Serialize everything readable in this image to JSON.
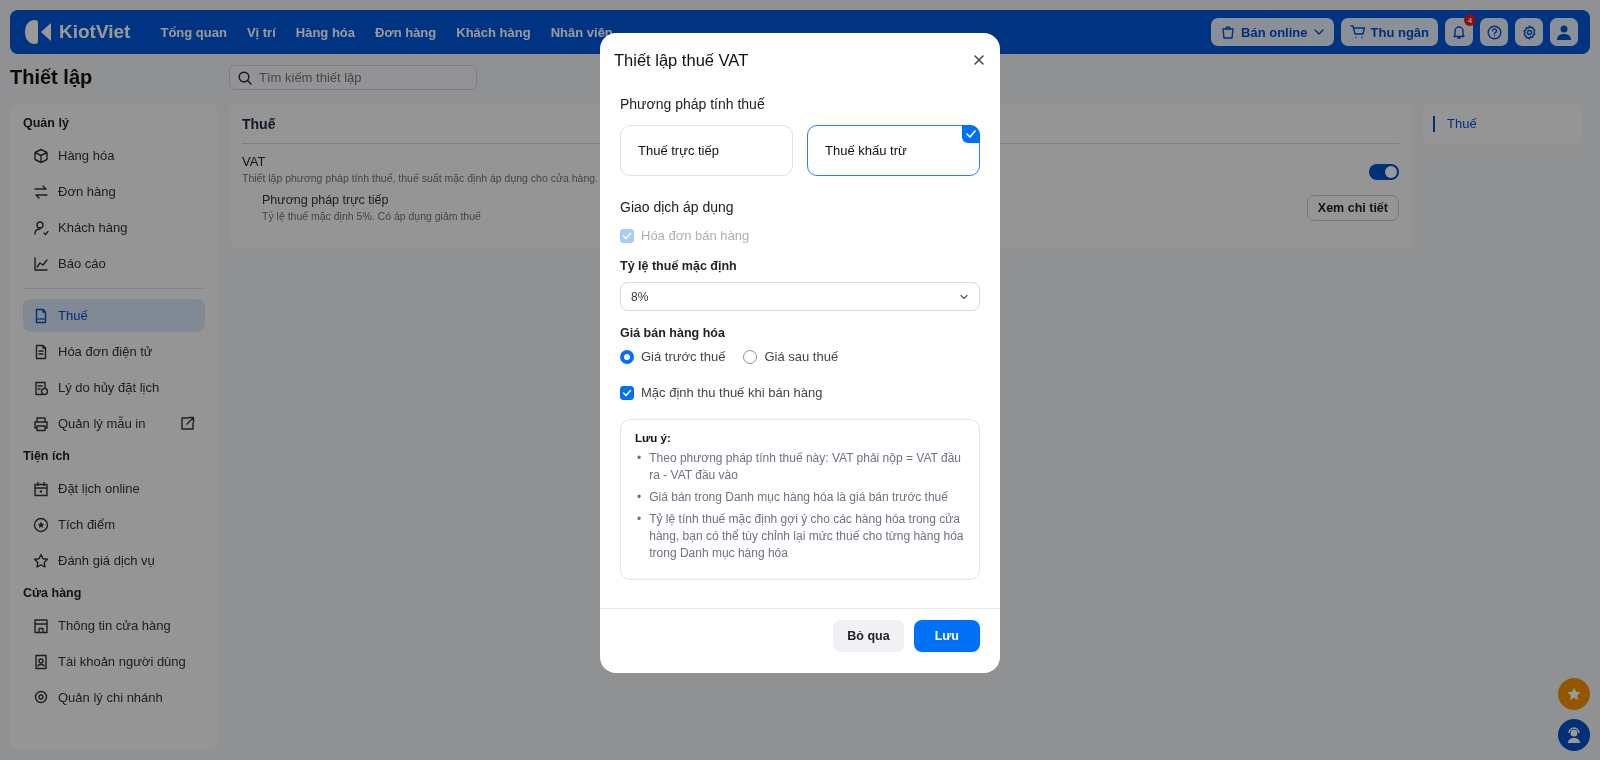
{
  "topbar": {
    "logo": "KiotViet",
    "nav": [
      "Tổng quan",
      "Vị trí",
      "Hàng hóa",
      "Đơn hàng",
      "Khách hàng",
      "Nhân viên"
    ],
    "online_button": "Bán online",
    "cashier_button": "Thu ngân",
    "notification_count": "4"
  },
  "page": {
    "title": "Thiết lập",
    "search": {
      "placeholder": "Tìm kiếm thiết lập"
    }
  },
  "sidebar": {
    "sections": [
      {
        "title": "Quản lý",
        "items": [
          {
            "label": "Hàng hóa",
            "selected": false
          },
          {
            "label": "Đơn hàng",
            "selected": false
          },
          {
            "label": "Khách hàng",
            "selected": false
          },
          {
            "label": "Báo cáo",
            "selected": false
          }
        ]
      },
      {
        "items": [
          {
            "label": "Thuế",
            "selected": true
          },
          {
            "label": "Hóa đơn điện tử",
            "selected": false
          },
          {
            "label": "Lý do hủy đặt lịch",
            "selected": false
          },
          {
            "label": "Quản lý mẫu in",
            "selected": false,
            "external": true
          }
        ]
      },
      {
        "title": "Tiện ích",
        "items": [
          {
            "label": "Đặt lịch online",
            "selected": false
          },
          {
            "label": "Tích điểm",
            "selected": false
          },
          {
            "label": "Đánh giá dịch vụ",
            "selected": false
          }
        ]
      },
      {
        "title": "Cửa hàng",
        "items": [
          {
            "label": "Thông tin cửa hàng",
            "selected": false
          },
          {
            "label": "Tài khoản người dùng",
            "selected": false
          },
          {
            "label": "Quản lý chi nhánh",
            "selected": false
          }
        ]
      }
    ]
  },
  "main": {
    "title": "Thuế",
    "setting": {
      "name": "VAT",
      "description": "Thiết lập phương pháp tính thuế, thuế suất mặc định áp dụng cho cửa hàng.",
      "on": true
    },
    "method": {
      "name": "Phương pháp trực tiếp",
      "note": "Tỷ lệ thuế mặc định 5%. Có áp dụng giảm thuế",
      "button": "Xem chi tiết"
    }
  },
  "right_nav": [
    {
      "label": "Thuế",
      "selected": true
    }
  ],
  "modal": {
    "title": "Thiết lập thuế VAT",
    "method_heading": "Phương pháp tính thuế",
    "methods": [
      {
        "label": "Thuế trực tiếp",
        "selected": false
      },
      {
        "label": "Thuế khấu trừ",
        "selected": true
      }
    ],
    "transaction_heading": "Giao dịch áp dụng",
    "transaction": {
      "label": "Hóa đơn bán hàng",
      "checked": true,
      "disabled": true
    },
    "rate_label": "Tỷ lệ thuế mặc định",
    "rate_value": "8%",
    "price_label": "Giá bán hàng hóa",
    "price_options": [
      {
        "label": "Giá trước thuế",
        "selected": true
      },
      {
        "label": "Giá sau thuế",
        "selected": false
      }
    ],
    "collect": {
      "label": "Mặc định thu thuế khi bán hàng",
      "checked": true
    },
    "note": {
      "title": "Lưu ý:",
      "bullet": "•",
      "items": [
        "Theo phương pháp tính thuế này: VAT phải nộp = VAT đầu ra - VAT đầu vào",
        "Giá bán trong Danh mục hàng hóa là giá bán trước thuế",
        "Tỷ lệ tính thuế mặc định gợi ý cho các hàng hóa trong cửa hàng, bạn có thể tùy chỉnh lại mức thuế cho từng hàng hóa trong Danh mục hàng hóa"
      ]
    },
    "cancel_button": "Bỏ qua",
    "save_button": "Lưu"
  }
}
